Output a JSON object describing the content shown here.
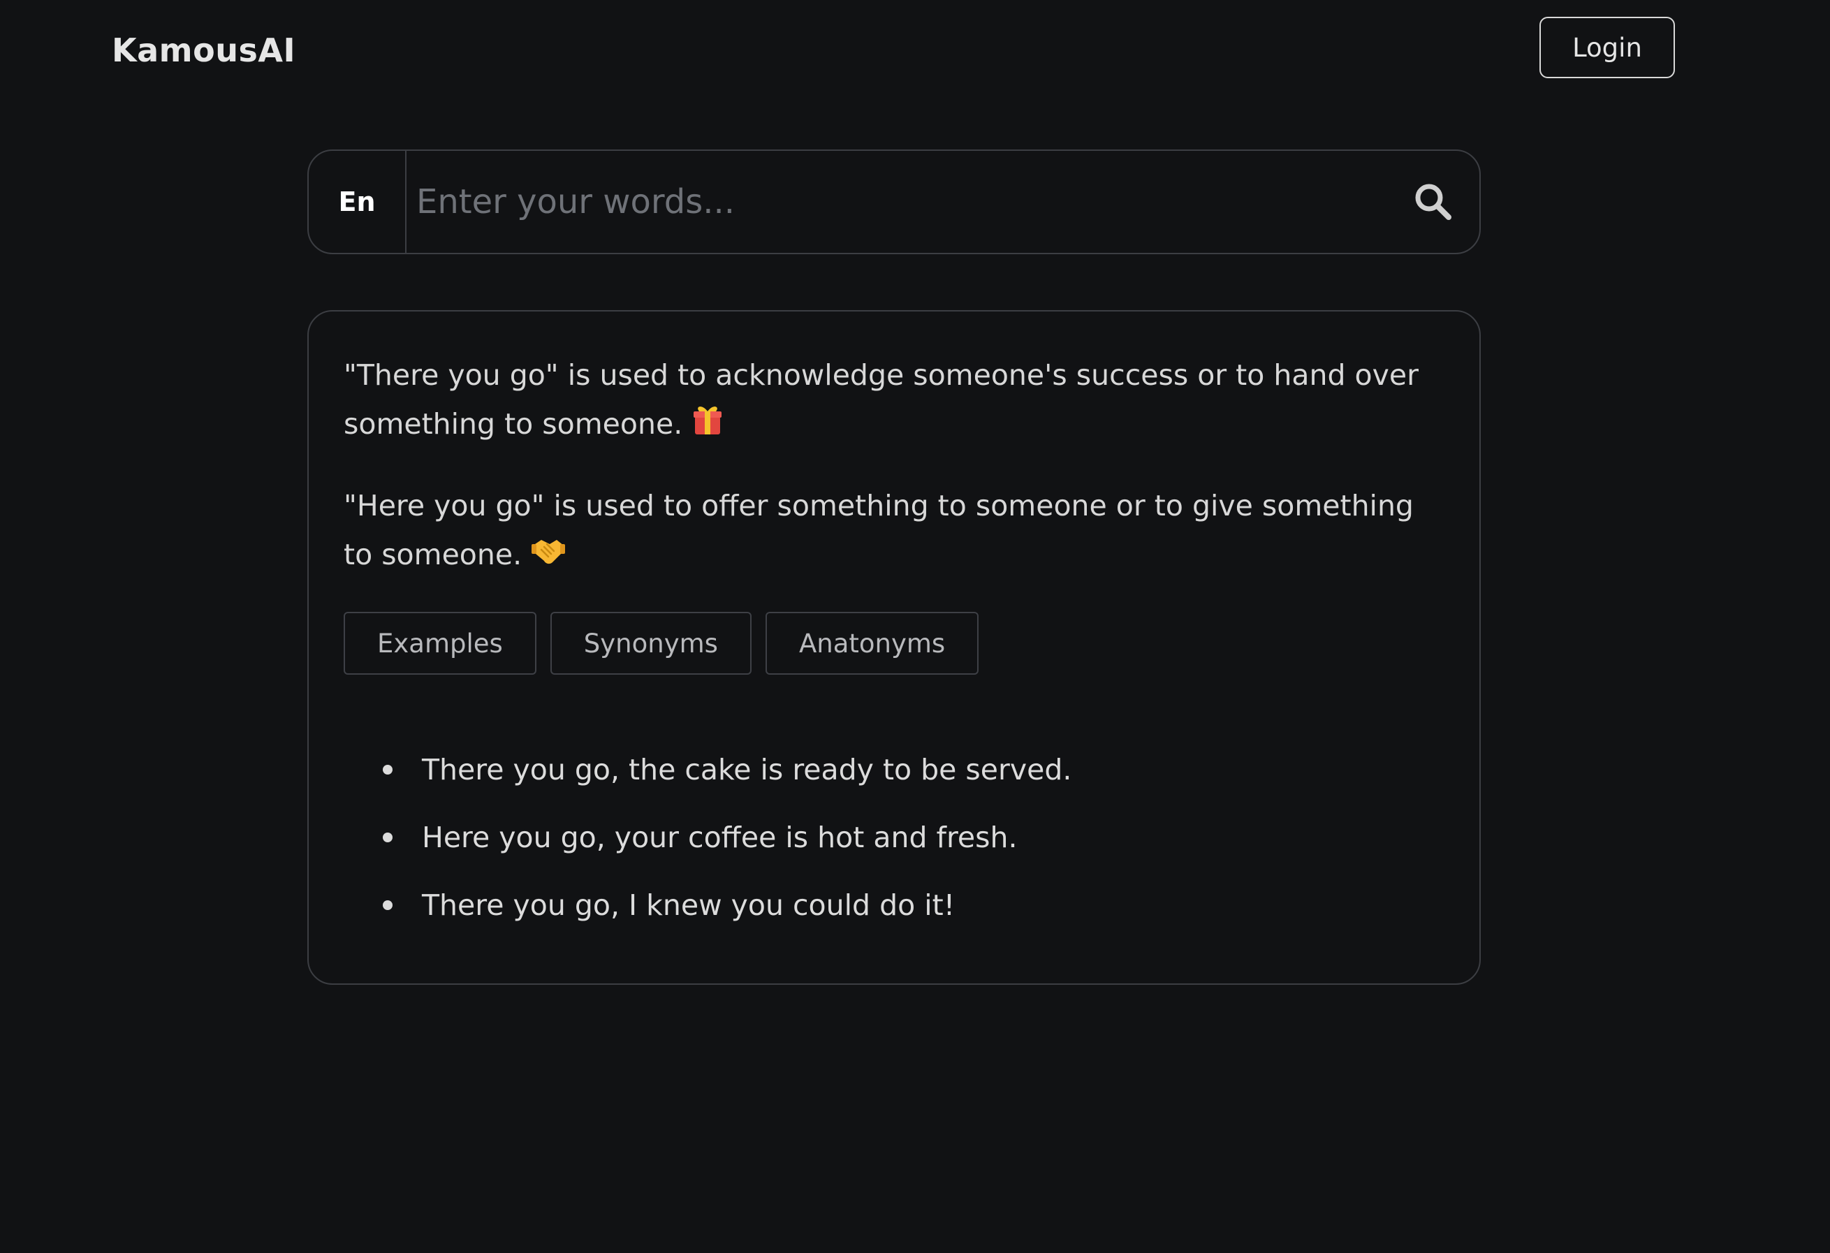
{
  "header": {
    "brand": "KamousAI",
    "login_label": "Login"
  },
  "search": {
    "language": "En",
    "placeholder": "Enter your words...",
    "value": "",
    "icon": "search-icon"
  },
  "result": {
    "definitions": [
      {
        "text": "\"There you go\" is used to acknowledge someone's success or to hand over something to someone.",
        "icon": "gift-icon"
      },
      {
        "text": "\"Here you go\" is used to offer something to someone or to give something to someone.",
        "icon": "handshake-icon"
      }
    ],
    "tabs": [
      {
        "label": "Examples"
      },
      {
        "label": "Synonyms"
      },
      {
        "label": "Anatonyms"
      }
    ],
    "examples": [
      "There you go, the cake is ready to be served.",
      "Here you go, your coffee is hot and fresh.",
      "There you go, I knew you could do it!"
    ]
  },
  "colors": {
    "background": "#111214",
    "border": "#3c3e43",
    "text": "#d8d8d8",
    "placeholder": "#6f7278",
    "gift_red": "#e2463f",
    "gift_yellow": "#f5c42c",
    "handshake_yellow": "#f7b733"
  }
}
